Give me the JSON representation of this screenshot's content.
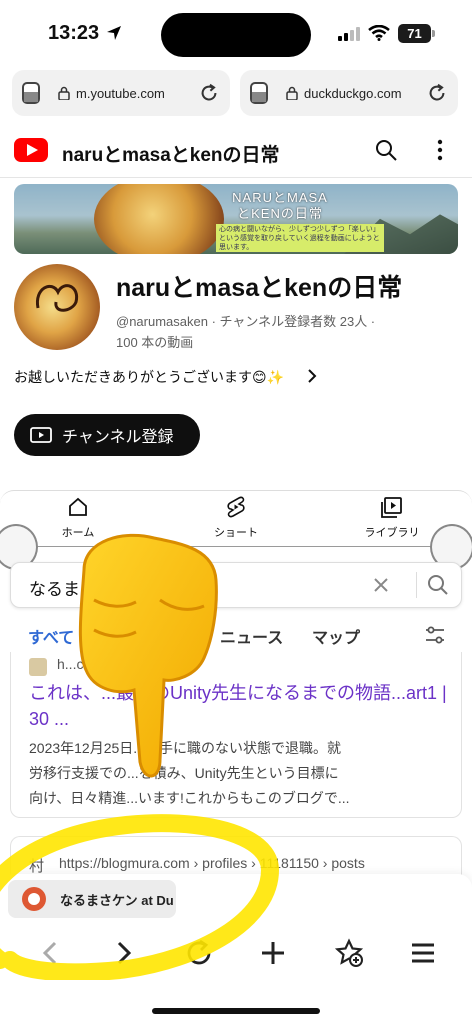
{
  "status_bar": {
    "time": "13:23",
    "battery": "71"
  },
  "browser_tabs": [
    {
      "url": "m.youtube.com"
    },
    {
      "url": "duckduckgo.com"
    }
  ],
  "youtube": {
    "header_title": "naruとmasaとkenの日常",
    "banner": {
      "title_line1": "NARUとMASA",
      "title_line2": "とKENの日常",
      "note": "心の病と闘いながら、少しずつ少しずつ「楽しい」という感覚を取り戻していく過程を動画にしようと思います。"
    },
    "channel": {
      "name": "naruとmasaとkenの日常",
      "handle_line": "@narumasaken · チャンネル登録者数 23人 ·",
      "videos_line": "100 本の動画",
      "description": "お越しいただきありがとうございます😊✨",
      "subscribe_label": "チャンネル登録"
    },
    "nav": [
      {
        "label": "ホーム"
      },
      {
        "label": "ショート"
      },
      {
        "label": "ライブラリ"
      }
    ]
  },
  "ddg": {
    "query": "なるま",
    "tabs": [
      {
        "label": "すべて"
      },
      {
        "label": "ニュース"
      },
      {
        "label": "マップ"
      }
    ],
    "results": [
      {
        "url": "h...com › 145",
        "title": "これは、...最高のUnity先生になるまでの物語...art1 | 30 ...",
        "snippet_line1": "2023年12月25日...も手に職のない状態で退職。就",
        "snippet_line2": "労移行支援での...を積み、Unity先生という目標に",
        "snippet_line3": "向け、日々精進...います!これからもこのブログで..."
      },
      {
        "favicon_text": "村",
        "url": "https://blogmura.com › profiles › 11181150 › posts"
      }
    ],
    "tab_preview_title": "なるまさケン at Du"
  },
  "colors": {
    "youtube_red": "#ff0000",
    "ddg_link": "#6b32c7",
    "ddg_active_tab": "#2f69d4",
    "highlight_yellow": "#ffe600",
    "ddg_orange": "#de5833"
  },
  "icons": [
    "location-arrow-icon",
    "signal-icon",
    "wifi-icon",
    "battery-icon",
    "tab-switcher-icon",
    "lock-icon",
    "reload-icon",
    "youtube-logo-icon",
    "search-icon",
    "more-vert-icon",
    "chevron-right-icon",
    "subscriptions-icon",
    "home-icon",
    "shorts-icon",
    "library-icon",
    "clear-icon",
    "filter-icon",
    "back-icon",
    "forward-icon",
    "plus-icon",
    "bookmark-star-icon",
    "menu-icon",
    "pointing-hand-emoji"
  ]
}
